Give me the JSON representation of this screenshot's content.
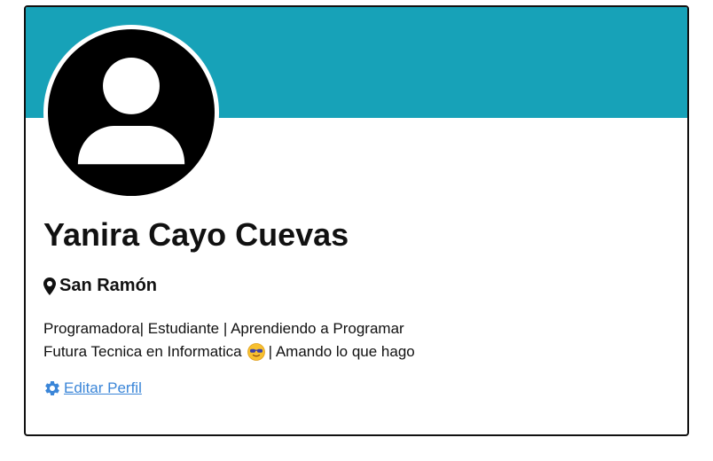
{
  "colors": {
    "banner": "#17a2b8",
    "link": "#3b86d8",
    "text": "#111111",
    "avatar": "#000000"
  },
  "profile": {
    "avatar_icon": "user-silhouette-icon",
    "name": "Yanira Cayo Cuevas",
    "location_icon": "map-pin-icon",
    "location": "San Ramón",
    "bio_line_1": "Programadora| Estudiante | Aprendiendo a Programar",
    "bio_line_2_before": "Futura Tecnica en Informatica",
    "bio_emoji": "sunglasses-face-emoji",
    "bio_line_2_after": "| Amando lo que hago"
  },
  "actions": {
    "edit_icon": "gear-icon",
    "edit_label": "Editar Perfil"
  }
}
